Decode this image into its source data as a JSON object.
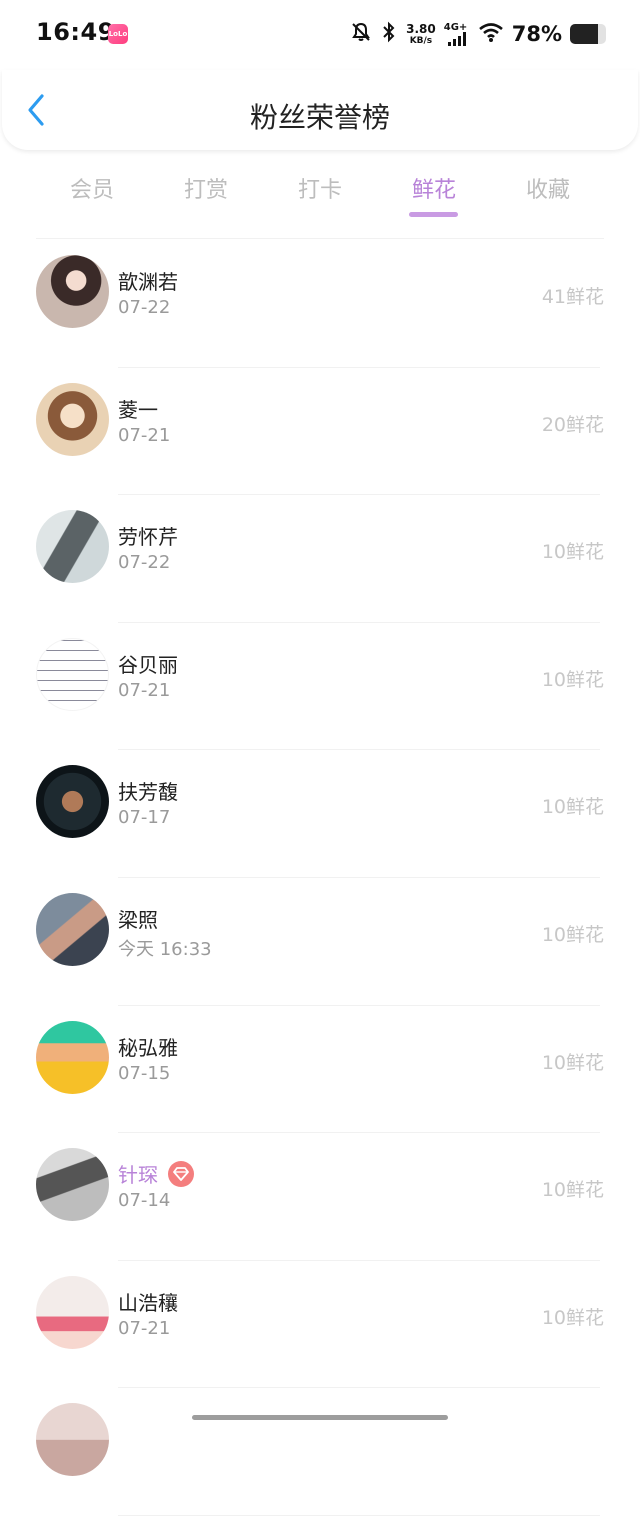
{
  "status_bar": {
    "time": "16:49",
    "app_icon_label": "LoLo",
    "net_speed_value": "3.80",
    "net_speed_unit": "KB/s",
    "network_type": "4G+",
    "battery_text": "78%",
    "battery_level": 0.78,
    "icons": [
      "mute-bell-icon",
      "bluetooth-icon",
      "signal-icon",
      "wifi-icon",
      "battery-icon"
    ]
  },
  "header": {
    "title": "粉丝荣誉榜",
    "back_icon": "chevron-left-icon"
  },
  "tabs": [
    {
      "label": "会员",
      "active": false
    },
    {
      "label": "打赏",
      "active": false
    },
    {
      "label": "打卡",
      "active": false
    },
    {
      "label": "鲜花",
      "active": true
    },
    {
      "label": "收藏",
      "active": false
    }
  ],
  "colors": {
    "accent": "#b883d8",
    "back_icon": "#2d9cf0",
    "vip_badge": "#f47e7e",
    "muted_text": "#9a9a9a",
    "amount_text": "#c7c7c7"
  },
  "fans": [
    {
      "name": "歆渊若",
      "date": "07-22",
      "amount": "41鲜花",
      "vip": false
    },
    {
      "name": "菱一",
      "date": "07-21",
      "amount": "20鲜花",
      "vip": false
    },
    {
      "name": "劳怀芹",
      "date": "07-22",
      "amount": "10鲜花",
      "vip": false
    },
    {
      "name": "谷贝丽",
      "date": "07-21",
      "amount": "10鲜花",
      "vip": false
    },
    {
      "name": "扶芳馥",
      "date": "07-17",
      "amount": "10鲜花",
      "vip": false
    },
    {
      "name": "梁照",
      "date": "今天 16:33",
      "amount": "10鲜花",
      "vip": false
    },
    {
      "name": "秘弘雅",
      "date": "07-15",
      "amount": "10鲜花",
      "vip": false
    },
    {
      "name": "针琛",
      "date": "07-14",
      "amount": "10鲜花",
      "vip": true
    },
    {
      "name": "山浩穰",
      "date": "07-21",
      "amount": "10鲜花",
      "vip": false
    }
  ]
}
